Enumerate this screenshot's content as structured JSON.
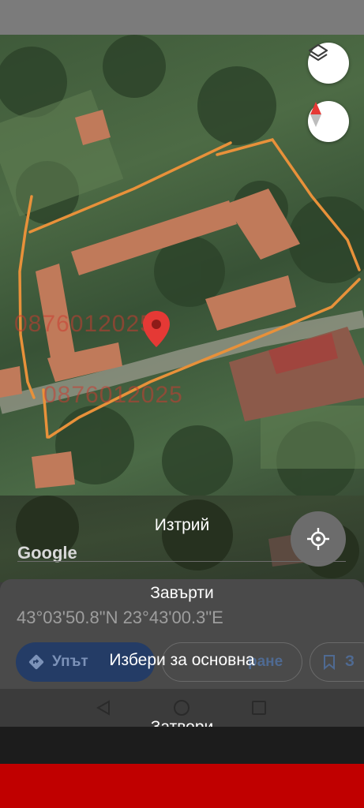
{
  "map": {
    "layers_icon": "layers-icon",
    "compass_icon": "compass-icon",
    "pin_icon": "map-pin-icon",
    "watermark_1": "0876012025",
    "watermark_2": "0876012025",
    "google_logo": "Google",
    "gps_icon": "my-location-icon"
  },
  "place_card": {
    "coordinates": "43°03'50.8\"N 23°43'00.3\"E",
    "route_label": "Упът",
    "save_label": "ране",
    "share_label": "З"
  },
  "menu": {
    "items": [
      "Изтрий",
      "Завърти",
      "Избери за основна",
      "Затвори"
    ]
  },
  "colors": {
    "boundary_line": "#e8913a",
    "pin": "#e53935",
    "red_band": "#c00000"
  }
}
